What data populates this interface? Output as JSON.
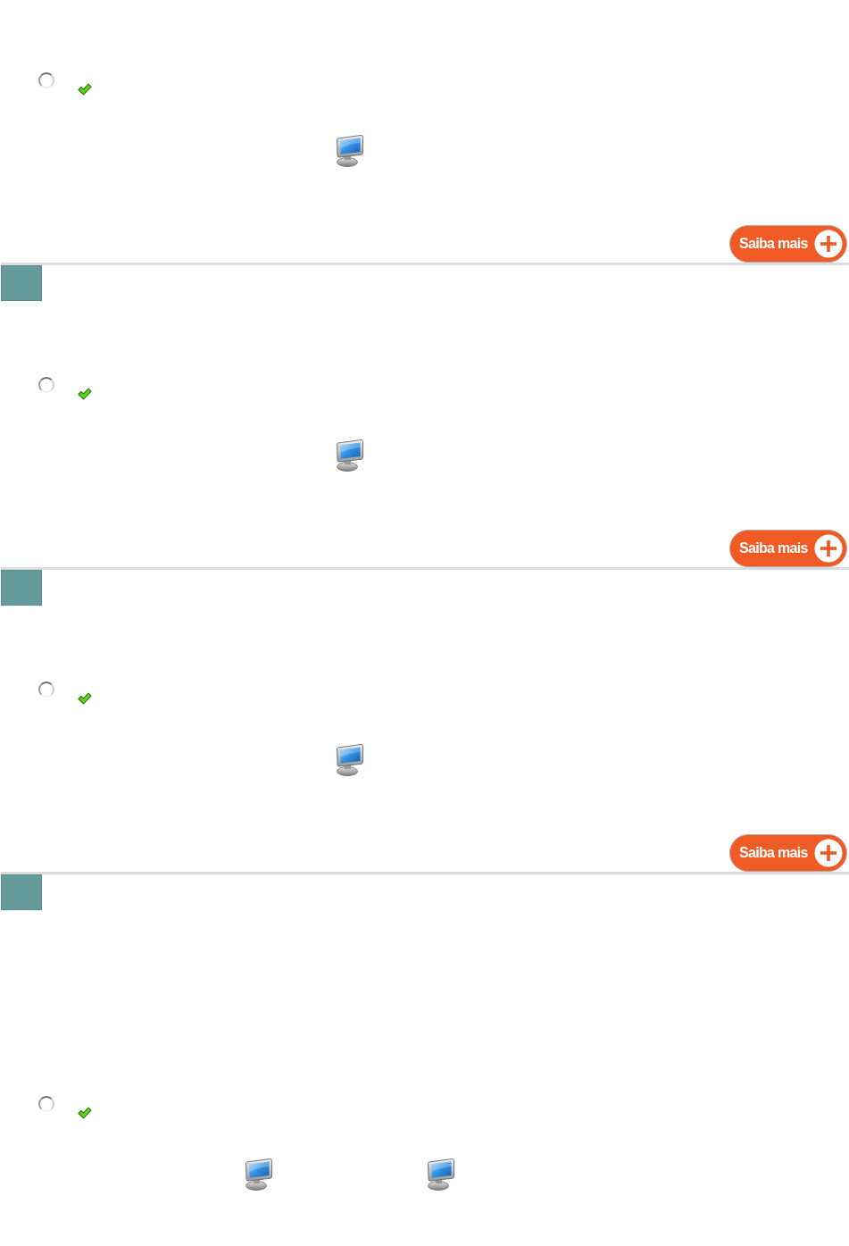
{
  "sections": [
    {
      "kind": "single",
      "option": {
        "selected": false
      },
      "button": {
        "label": "Saiba mais"
      }
    },
    {
      "kind": "single",
      "option": {
        "selected": false
      },
      "button": {
        "label": "Saiba mais"
      }
    },
    {
      "kind": "single",
      "option": {
        "selected": false
      },
      "button": {
        "label": "Saiba mais"
      }
    },
    {
      "kind": "dual",
      "option": {
        "selected": false
      }
    }
  ]
}
